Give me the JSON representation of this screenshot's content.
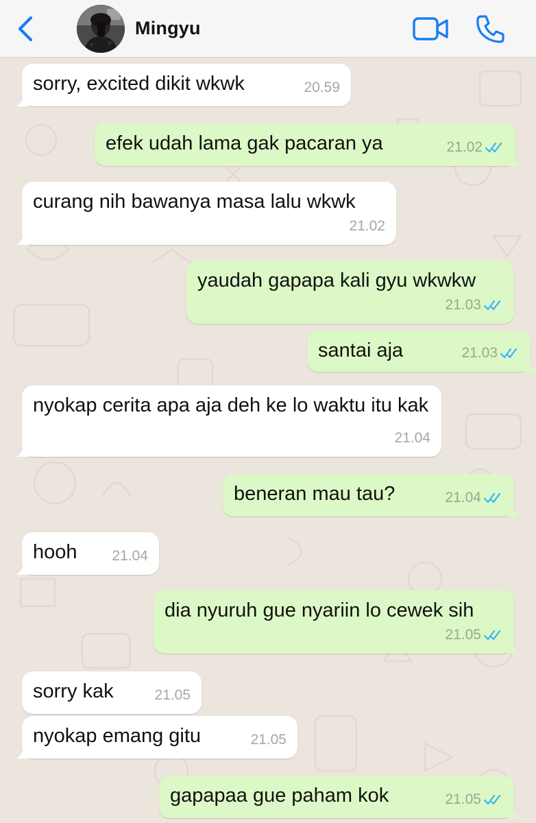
{
  "header": {
    "contact_name": "Mingyu"
  },
  "icons": {
    "back": "chevron-left-icon",
    "video": "video-camera-icon",
    "call": "phone-icon",
    "read_receipt": "double-check-icon"
  },
  "colors": {
    "accent": "#1a7cf2",
    "incoming_bubble": "#ffffff",
    "outgoing_bubble": "#dcf8c6",
    "read_tick": "#34b7f1",
    "wallpaper": "#ece5dd"
  },
  "messages": [
    {
      "dir": "in",
      "text": "sorry, excited dikit wkwk",
      "time": "20.59"
    },
    {
      "dir": "out",
      "text": "efek udah lama gak pacaran ya",
      "time": "21.02",
      "read": true
    },
    {
      "dir": "in",
      "text": "curang nih bawanya masa lalu wkwk",
      "time": "21.02"
    },
    {
      "dir": "out",
      "text": "yaudah gapapa kali gyu wkwkw",
      "time": "21.03",
      "read": true
    },
    {
      "dir": "out",
      "text": "santai aja",
      "time": "21.03",
      "read": true
    },
    {
      "dir": "in",
      "text": "nyokap cerita apa aja deh ke lo waktu itu kak",
      "time": "21.04"
    },
    {
      "dir": "out",
      "text": "beneran mau tau?",
      "time": "21.04",
      "read": true
    },
    {
      "dir": "in",
      "text": "hooh",
      "time": "21.04"
    },
    {
      "dir": "out",
      "text": "dia nyuruh gue nyariin lo cewek sih",
      "time": "21.05",
      "read": true
    },
    {
      "dir": "in",
      "text": "sorry kak",
      "time": "21.05"
    },
    {
      "dir": "in",
      "text": "nyokap emang gitu",
      "time": "21.05"
    },
    {
      "dir": "out",
      "text": "gapapaa gue paham kok",
      "time": "21.05",
      "read": true
    }
  ]
}
